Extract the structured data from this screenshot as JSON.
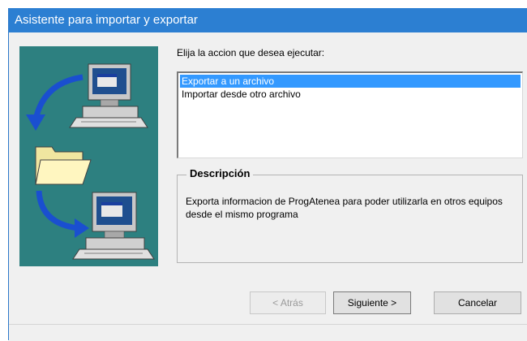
{
  "window": {
    "title": "Asistente para importar y exportar"
  },
  "prompt": "Elija la accion que desea ejecutar:",
  "actions": [
    {
      "label": "Exportar a un archivo",
      "selected": true
    },
    {
      "label": "Importar desde otro archivo",
      "selected": false
    }
  ],
  "description": {
    "title": "Descripción",
    "text": "Exporta informacion de ProgAtenea para poder utilizarla en otros equipos desde el mismo programa"
  },
  "buttons": {
    "back": "< Atrás",
    "next": "Siguiente >",
    "cancel": "Cancelar"
  },
  "colors": {
    "titlebar": "#2c7fd2",
    "art_background": "#2d8080",
    "selection": "#3399ff"
  }
}
